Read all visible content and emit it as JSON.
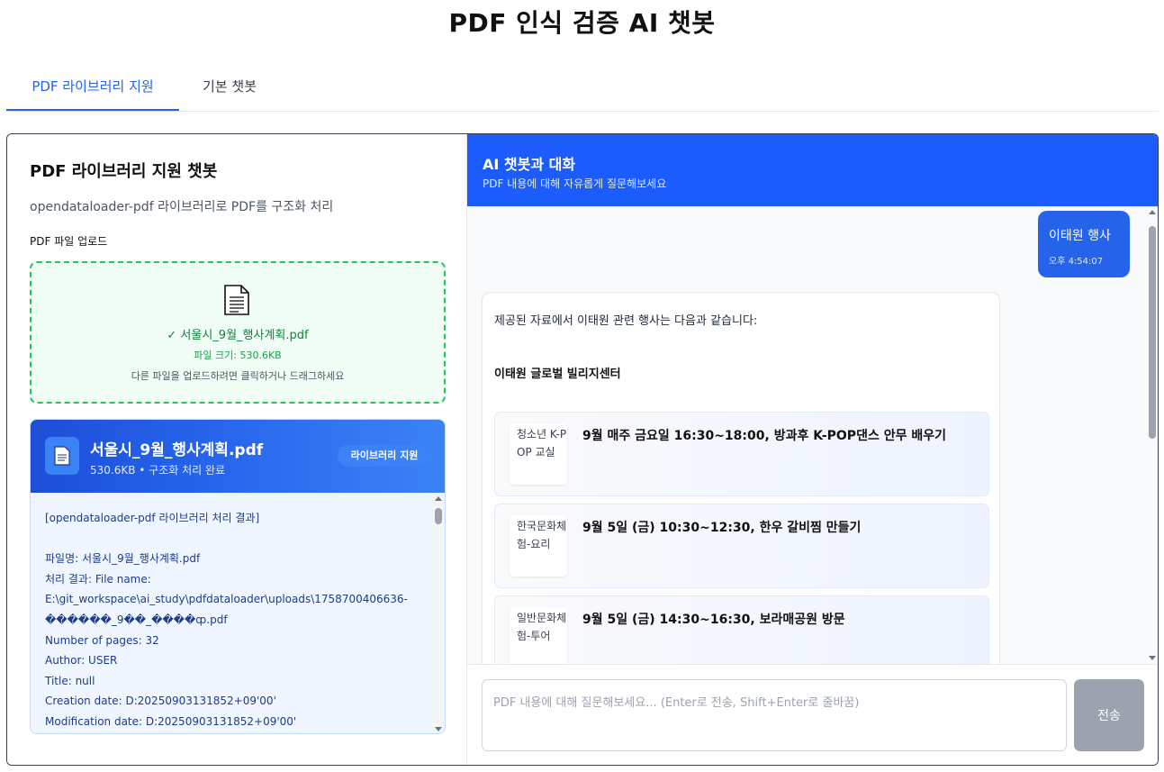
{
  "page": {
    "title": "PDF 인식 검증 AI 챗봇"
  },
  "tabs": [
    {
      "label": "PDF 라이브러리 지원",
      "active": true
    },
    {
      "label": "기본 챗봇",
      "active": false
    }
  ],
  "left": {
    "title": "PDF 라이브러리 지원 챗봇",
    "subtitle": "opendataloader-pdf 라이브러리로 PDF를 구조화 처리",
    "upload_label": "PDF 파일 업로드",
    "dropzone": {
      "icon": "document-icon",
      "file_name": "✓ 서울시_9월_행사계획.pdf",
      "file_size": "파일 크기: 530.6KB",
      "hint": "다른 파일을 업로드하려면 클릭하거나 드래그하세요"
    },
    "doc": {
      "name": "서울시_9월_행사계획.pdf",
      "meta": "530.6KB • 구조화 처리 완료",
      "badge": "라이브러리 지원",
      "lines": [
        "[opendataloader-pdf 라이브러리 처리 결과]",
        "",
        "파일명: 서울시_9월_행사계획.pdf",
        "처리 결과: File name:",
        "E:\\git_workspace\\ai_study\\pdfdataloader\\uploads\\1758700406636-",
        "������_9��_����ȹ.pdf",
        "Number of pages: 32",
        "Author: USER",
        "Title: null",
        "Creation date: D:20250903131852+09'00'",
        "Modification date: D:20250903131852+09'00'"
      ]
    }
  },
  "chat": {
    "title": "AI 챗봇과 대화",
    "subtitle": "PDF 내용에 대해 자유롭게 질문해보세요",
    "user_message": {
      "text": "이태원 행사",
      "time": "오후 4:54:07"
    },
    "ai_message": {
      "intro": "제공된 자료에서 이태원 관련 행사는 다음과 같습니다:",
      "heading": "이태원 글로벌 빌리지센터",
      "events": [
        {
          "tag": "청소년 K-POP 교실",
          "title": "9월 매주 금요일 16:30~18:00, 방과후 K-POP댄스 안무 배우기"
        },
        {
          "tag": "한국문화체험-요리",
          "title": "9월 5일 (금) 10:30~12:30, 한우 갈비찜 만들기"
        },
        {
          "tag": "일반문화체험-투어",
          "title": "9월 5일 (금) 14:30~16:30, 보라매공원 방문"
        }
      ]
    },
    "input": {
      "placeholder": "PDF 내용에 대해 질문해보세요... (Enter로 전송, Shift+Enter로 줄바꿈)",
      "value": ""
    },
    "send_label": "전송"
  },
  "colors": {
    "accent": "#2563eb",
    "header": "#1d5cfc",
    "success": "#22c55e",
    "send_disabled": "#9ca3af"
  }
}
